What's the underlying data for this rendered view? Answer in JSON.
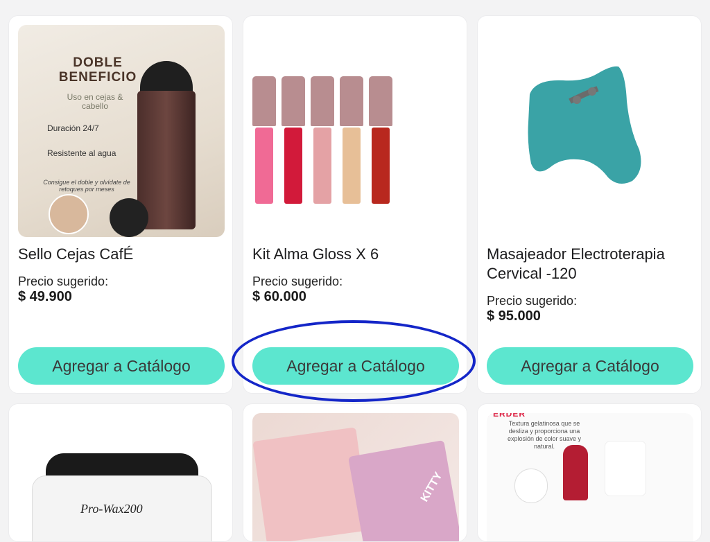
{
  "products": [
    {
      "title": "Sello Cejas CafÉ",
      "price_label": "Precio sugerido:",
      "price": "$ 49.900",
      "button": "Agregar a Catálogo",
      "image_text": {
        "heading": "DOBLE BENEFICIO",
        "sub": "Uso en cejas & cabello",
        "feature1": "Duración 24/7",
        "feature2": "Resistente al agua",
        "caption": "Consigue el doble y olvídate de retoques por meses"
      }
    },
    {
      "title": "Kit Alma Gloss X 6",
      "price_label": "Precio sugerido:",
      "price": "$ 60.000",
      "button": "Agregar a Catálogo"
    },
    {
      "title": "Masajeador Electroterapia Cervical -120",
      "price_label": "Precio sugerido:",
      "price": "$ 95.000",
      "button": "Agregar a Catálogo"
    }
  ],
  "row2": [
    {
      "image_text": "Pro-Wax200"
    },
    {
      "image_text": "KITTY"
    },
    {
      "image_text": "Textura gelatinosa que se desliza y proporciona una explosión de color suave y natural.",
      "header": "PERDER"
    }
  ],
  "colors": {
    "button": "#5ce6cf",
    "annotation": "#1426c8"
  }
}
